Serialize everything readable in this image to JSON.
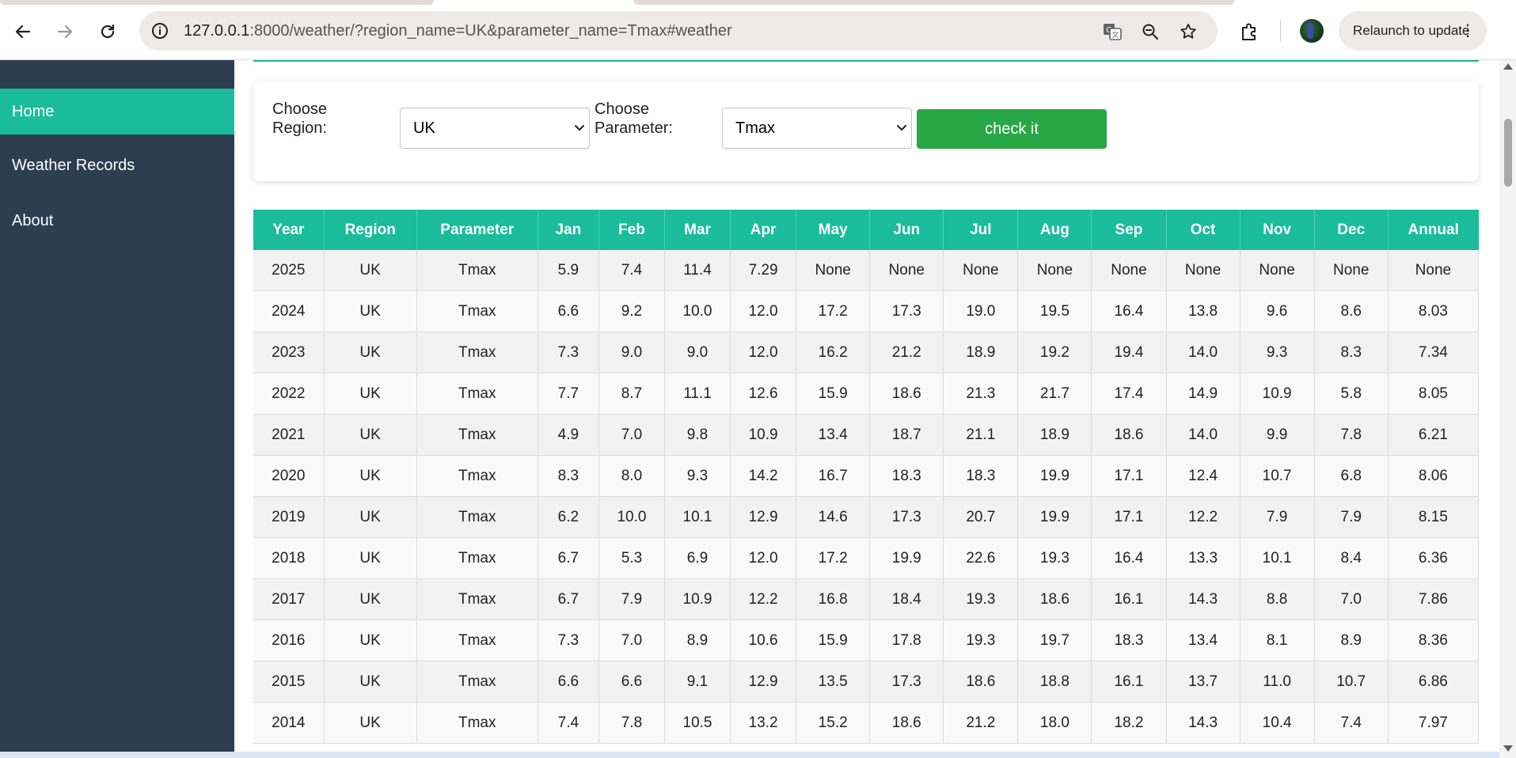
{
  "browser": {
    "url_host": "127.0.0.1",
    "url_path": ":8000/weather/?region_name=UK&parameter_name=Tmax#weather",
    "relaunch_label": "Relaunch to update",
    "menu_glyph": "⋮"
  },
  "sidebar": {
    "items": [
      {
        "label": "Home",
        "active": true
      },
      {
        "label": "Weather Records",
        "active": false
      },
      {
        "label": "About",
        "active": false
      }
    ]
  },
  "filters": {
    "region_label": "Choose Region:",
    "region_value": "UK",
    "parameter_label": "Choose Parameter:",
    "parameter_value": "Tmax",
    "submit_label": "check it"
  },
  "table": {
    "headers": [
      "Year",
      "Region",
      "Parameter",
      "Jan",
      "Feb",
      "Mar",
      "Apr",
      "May",
      "Jun",
      "Jul",
      "Aug",
      "Sep",
      "Oct",
      "Nov",
      "Dec",
      "Annual"
    ],
    "rows": [
      [
        "2025",
        "UK",
        "Tmax",
        "5.9",
        "7.4",
        "11.4",
        "7.29",
        "None",
        "None",
        "None",
        "None",
        "None",
        "None",
        "None",
        "None",
        "None"
      ],
      [
        "2024",
        "UK",
        "Tmax",
        "6.6",
        "9.2",
        "10.0",
        "12.0",
        "17.2",
        "17.3",
        "19.0",
        "19.5",
        "16.4",
        "13.8",
        "9.6",
        "8.6",
        "8.03"
      ],
      [
        "2023",
        "UK",
        "Tmax",
        "7.3",
        "9.0",
        "9.0",
        "12.0",
        "16.2",
        "21.2",
        "18.9",
        "19.2",
        "19.4",
        "14.0",
        "9.3",
        "8.3",
        "7.34"
      ],
      [
        "2022",
        "UK",
        "Tmax",
        "7.7",
        "8.7",
        "11.1",
        "12.6",
        "15.9",
        "18.6",
        "21.3",
        "21.7",
        "17.4",
        "14.9",
        "10.9",
        "5.8",
        "8.05"
      ],
      [
        "2021",
        "UK",
        "Tmax",
        "4.9",
        "7.0",
        "9.8",
        "10.9",
        "13.4",
        "18.7",
        "21.1",
        "18.9",
        "18.6",
        "14.0",
        "9.9",
        "7.8",
        "6.21"
      ],
      [
        "2020",
        "UK",
        "Tmax",
        "8.3",
        "8.0",
        "9.3",
        "14.2",
        "16.7",
        "18.3",
        "18.3",
        "19.9",
        "17.1",
        "12.4",
        "10.7",
        "6.8",
        "8.06"
      ],
      [
        "2019",
        "UK",
        "Tmax",
        "6.2",
        "10.0",
        "10.1",
        "12.9",
        "14.6",
        "17.3",
        "20.7",
        "19.9",
        "17.1",
        "12.2",
        "7.9",
        "7.9",
        "8.15"
      ],
      [
        "2018",
        "UK",
        "Tmax",
        "6.7",
        "5.3",
        "6.9",
        "12.0",
        "17.2",
        "19.9",
        "22.6",
        "19.3",
        "16.4",
        "13.3",
        "10.1",
        "8.4",
        "6.36"
      ],
      [
        "2017",
        "UK",
        "Tmax",
        "6.7",
        "7.9",
        "10.9",
        "12.2",
        "16.8",
        "18.4",
        "19.3",
        "18.6",
        "16.1",
        "14.3",
        "8.8",
        "7.0",
        "7.86"
      ],
      [
        "2016",
        "UK",
        "Tmax",
        "7.3",
        "7.0",
        "8.9",
        "10.6",
        "15.9",
        "17.8",
        "19.3",
        "19.7",
        "18.3",
        "13.4",
        "8.1",
        "8.9",
        "8.36"
      ],
      [
        "2015",
        "UK",
        "Tmax",
        "6.6",
        "6.6",
        "9.1",
        "12.9",
        "13.5",
        "17.3",
        "18.6",
        "18.8",
        "16.1",
        "13.7",
        "11.0",
        "10.7",
        "6.86"
      ],
      [
        "2014",
        "UK",
        "Tmax",
        "7.4",
        "7.8",
        "10.5",
        "13.2",
        "15.2",
        "18.6",
        "21.2",
        "18.0",
        "18.2",
        "14.3",
        "10.4",
        "7.4",
        "7.97"
      ]
    ]
  },
  "colors": {
    "sidebar_bg": "#2c3e50",
    "accent": "#1abc9c",
    "button": "#28a745"
  }
}
